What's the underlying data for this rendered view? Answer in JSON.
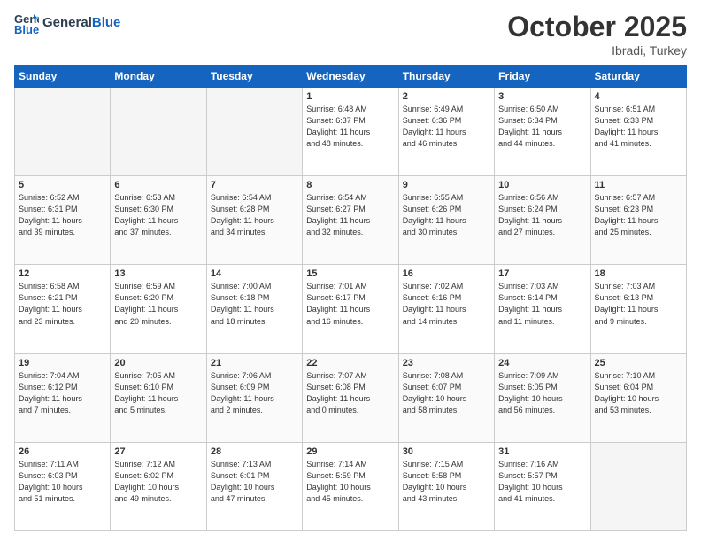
{
  "header": {
    "logo_general": "General",
    "logo_blue": "Blue",
    "month": "October 2025",
    "location": "Ibradi, Turkey"
  },
  "days_of_week": [
    "Sunday",
    "Monday",
    "Tuesday",
    "Wednesday",
    "Thursday",
    "Friday",
    "Saturday"
  ],
  "weeks": [
    [
      {
        "day": "",
        "info": ""
      },
      {
        "day": "",
        "info": ""
      },
      {
        "day": "",
        "info": ""
      },
      {
        "day": "1",
        "info": "Sunrise: 6:48 AM\nSunset: 6:37 PM\nDaylight: 11 hours\nand 48 minutes."
      },
      {
        "day": "2",
        "info": "Sunrise: 6:49 AM\nSunset: 6:36 PM\nDaylight: 11 hours\nand 46 minutes."
      },
      {
        "day": "3",
        "info": "Sunrise: 6:50 AM\nSunset: 6:34 PM\nDaylight: 11 hours\nand 44 minutes."
      },
      {
        "day": "4",
        "info": "Sunrise: 6:51 AM\nSunset: 6:33 PM\nDaylight: 11 hours\nand 41 minutes."
      }
    ],
    [
      {
        "day": "5",
        "info": "Sunrise: 6:52 AM\nSunset: 6:31 PM\nDaylight: 11 hours\nand 39 minutes."
      },
      {
        "day": "6",
        "info": "Sunrise: 6:53 AM\nSunset: 6:30 PM\nDaylight: 11 hours\nand 37 minutes."
      },
      {
        "day": "7",
        "info": "Sunrise: 6:54 AM\nSunset: 6:28 PM\nDaylight: 11 hours\nand 34 minutes."
      },
      {
        "day": "8",
        "info": "Sunrise: 6:54 AM\nSunset: 6:27 PM\nDaylight: 11 hours\nand 32 minutes."
      },
      {
        "day": "9",
        "info": "Sunrise: 6:55 AM\nSunset: 6:26 PM\nDaylight: 11 hours\nand 30 minutes."
      },
      {
        "day": "10",
        "info": "Sunrise: 6:56 AM\nSunset: 6:24 PM\nDaylight: 11 hours\nand 27 minutes."
      },
      {
        "day": "11",
        "info": "Sunrise: 6:57 AM\nSunset: 6:23 PM\nDaylight: 11 hours\nand 25 minutes."
      }
    ],
    [
      {
        "day": "12",
        "info": "Sunrise: 6:58 AM\nSunset: 6:21 PM\nDaylight: 11 hours\nand 23 minutes."
      },
      {
        "day": "13",
        "info": "Sunrise: 6:59 AM\nSunset: 6:20 PM\nDaylight: 11 hours\nand 20 minutes."
      },
      {
        "day": "14",
        "info": "Sunrise: 7:00 AM\nSunset: 6:18 PM\nDaylight: 11 hours\nand 18 minutes."
      },
      {
        "day": "15",
        "info": "Sunrise: 7:01 AM\nSunset: 6:17 PM\nDaylight: 11 hours\nand 16 minutes."
      },
      {
        "day": "16",
        "info": "Sunrise: 7:02 AM\nSunset: 6:16 PM\nDaylight: 11 hours\nand 14 minutes."
      },
      {
        "day": "17",
        "info": "Sunrise: 7:03 AM\nSunset: 6:14 PM\nDaylight: 11 hours\nand 11 minutes."
      },
      {
        "day": "18",
        "info": "Sunrise: 7:03 AM\nSunset: 6:13 PM\nDaylight: 11 hours\nand 9 minutes."
      }
    ],
    [
      {
        "day": "19",
        "info": "Sunrise: 7:04 AM\nSunset: 6:12 PM\nDaylight: 11 hours\nand 7 minutes."
      },
      {
        "day": "20",
        "info": "Sunrise: 7:05 AM\nSunset: 6:10 PM\nDaylight: 11 hours\nand 5 minutes."
      },
      {
        "day": "21",
        "info": "Sunrise: 7:06 AM\nSunset: 6:09 PM\nDaylight: 11 hours\nand 2 minutes."
      },
      {
        "day": "22",
        "info": "Sunrise: 7:07 AM\nSunset: 6:08 PM\nDaylight: 11 hours\nand 0 minutes."
      },
      {
        "day": "23",
        "info": "Sunrise: 7:08 AM\nSunset: 6:07 PM\nDaylight: 10 hours\nand 58 minutes."
      },
      {
        "day": "24",
        "info": "Sunrise: 7:09 AM\nSunset: 6:05 PM\nDaylight: 10 hours\nand 56 minutes."
      },
      {
        "day": "25",
        "info": "Sunrise: 7:10 AM\nSunset: 6:04 PM\nDaylight: 10 hours\nand 53 minutes."
      }
    ],
    [
      {
        "day": "26",
        "info": "Sunrise: 7:11 AM\nSunset: 6:03 PM\nDaylight: 10 hours\nand 51 minutes."
      },
      {
        "day": "27",
        "info": "Sunrise: 7:12 AM\nSunset: 6:02 PM\nDaylight: 10 hours\nand 49 minutes."
      },
      {
        "day": "28",
        "info": "Sunrise: 7:13 AM\nSunset: 6:01 PM\nDaylight: 10 hours\nand 47 minutes."
      },
      {
        "day": "29",
        "info": "Sunrise: 7:14 AM\nSunset: 5:59 PM\nDaylight: 10 hours\nand 45 minutes."
      },
      {
        "day": "30",
        "info": "Sunrise: 7:15 AM\nSunset: 5:58 PM\nDaylight: 10 hours\nand 43 minutes."
      },
      {
        "day": "31",
        "info": "Sunrise: 7:16 AM\nSunset: 5:57 PM\nDaylight: 10 hours\nand 41 minutes."
      },
      {
        "day": "",
        "info": ""
      }
    ]
  ]
}
